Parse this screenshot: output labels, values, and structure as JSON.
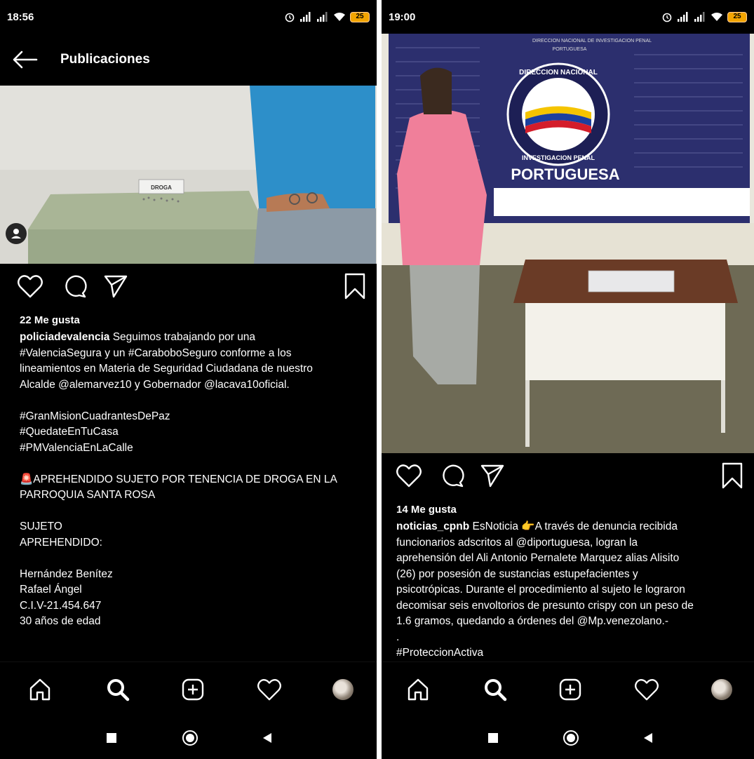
{
  "left": {
    "status": {
      "time": "18:56",
      "battery": "25"
    },
    "topbar": {
      "title": "Publicaciones"
    },
    "photo": {
      "label": "DROGA"
    },
    "likes": "22 Me gusta",
    "caption": {
      "username": "policiadevalencia",
      "first_line": "Seguimos trabajando por una",
      "lines": [
        "#ValenciaSegura y un #CaraboboSeguro conforme a los",
        "lineamientos en Materia de Seguridad Ciudadana de nuestro",
        "Alcalde @alemarvez10 y Gobernador @lacava10oficial.",
        "",
        "#GranMisionCuadrantesDePaz",
        "#QuedateEnTuCasa",
        "#PMValenciaEnLaCalle",
        "",
        "🚨APREHENDIDO SUJETO POR TENENCIA DE DROGA EN LA",
        "PARROQUIA SANTA ROSA",
        "",
        "SUJETO",
        "APREHENDIDO:",
        "",
        "Hernández Benítez",
        "Rafael Ángel",
        "C.I.V-21.454.647",
        "30 años de edad"
      ]
    }
  },
  "right": {
    "status": {
      "time": "19:00",
      "battery": "25"
    },
    "photo": {
      "banner_top": "DIRECCION NACIONAL DE INVESTIGACION PENAL",
      "banner_sub": "PORTUGUESA",
      "seal_top": "DIRECCION NACIONAL",
      "seal_bottom": "INVESTIGACION PENAL",
      "banner_main": "PORTUGUESA"
    },
    "likes": "14 Me gusta",
    "caption": {
      "username": "noticias_cpnb",
      "first_line": "EsNoticia 👉A través de denuncia recibida",
      "lines": [
        "funcionarios adscritos al @diportuguesa, logran la",
        "aprehensión del Ali Antonio Pernalete Marquez alias  Alisito",
        "(26) por posesión de sustancias estupefacientes y",
        "psicotrópicas. Durante el procedimiento al sujeto le lograron",
        "decomisar seis envoltorios de presunto crispy con un peso de",
        "1.6  gramos, quedando a órdenes del @Mp.venezolano.-",
        ".",
        "#ProteccionActiva"
      ]
    }
  },
  "icons": {
    "back": "arrow-left-icon",
    "like": "heart-icon",
    "comment": "comment-icon",
    "share": "send-icon",
    "save": "bookmark-icon",
    "home": "home-icon",
    "search": "search-icon",
    "add": "add-post-icon",
    "activity": "heart-icon",
    "profile": "avatar",
    "recents": "square-icon",
    "home_sys": "circle-icon",
    "back_sys": "triangle-icon"
  },
  "colors": {
    "background": "#000000",
    "text": "#ffffff",
    "battery": "#f2a400"
  }
}
